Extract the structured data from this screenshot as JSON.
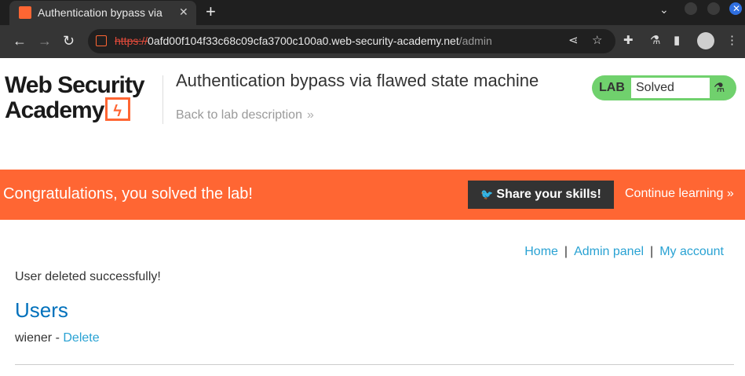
{
  "browser": {
    "tab_title": "Authentication bypass via",
    "tab_close": "✕",
    "new_tab": "+",
    "url_scheme": "https://",
    "url_host": "0afd00f104f33c68c09cfa3700c100a0.web-security-academy.net",
    "url_path": "/admin"
  },
  "logo": {
    "line1": "Web Security",
    "line2": "Academy"
  },
  "lab": {
    "title": "Authentication bypass via flawed state machine",
    "back_link": "Back to lab description",
    "status_label": "LAB",
    "status_value": "Solved"
  },
  "banner": {
    "message": "Congratulations, you solved the lab!",
    "share_button": "Share your skills!",
    "continue_link": "Continue learning"
  },
  "nav": {
    "home": "Home",
    "admin_panel": "Admin panel",
    "my_account": "My account",
    "separator": "|"
  },
  "content": {
    "message": "User deleted successfully!",
    "heading": "Users",
    "users": [
      {
        "name": "wiener",
        "separator": "-",
        "action": "Delete"
      }
    ]
  },
  "colors": {
    "brand": "#ff6633",
    "link": "#29a2d3",
    "heading": "#0071bc",
    "lab_green": "#70d16d"
  }
}
